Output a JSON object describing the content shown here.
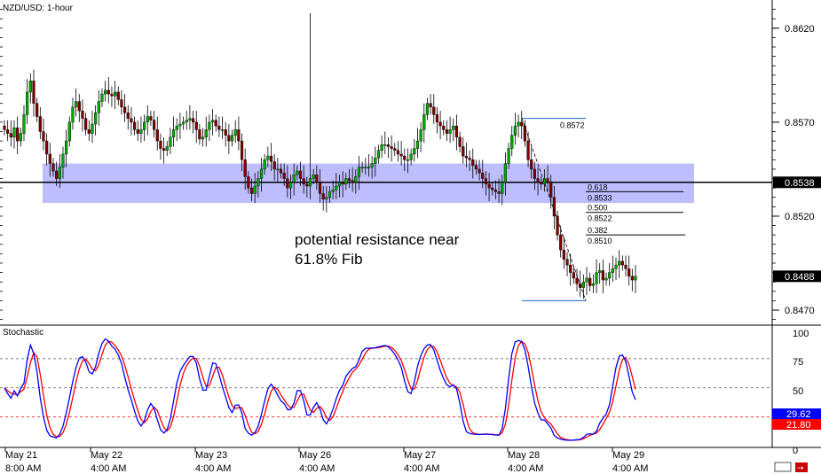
{
  "chart_data": {
    "type": "candlestick",
    "title": "NZD/USD: 1-hour",
    "price_axis": {
      "min": 0.8462,
      "max": 0.8635,
      "tick_labels": [
        "0.8620",
        "0.8570",
        "0.8520",
        "0.8470"
      ],
      "tick_values": [
        0.862,
        0.857,
        0.852,
        0.847
      ]
    },
    "time_axis": {
      "labels": [
        {
          "date": "May 21",
          "time": "8:00 AM"
        },
        {
          "date": "May 22",
          "time": "4:00 AM"
        },
        {
          "date": "May 23",
          "time": "4:00 AM"
        },
        {
          "date": "May 26",
          "time": "4:00 AM"
        },
        {
          "date": "May 27",
          "time": "4:00 AM"
        },
        {
          "date": "May 28",
          "time": "4:00 AM"
        },
        {
          "date": "May 29",
          "time": "4:00 AM"
        }
      ]
    },
    "current_price": {
      "label": "0.8488",
      "value": 0.8488
    },
    "horizontal_line": {
      "label": "0.8538",
      "value": 0.8538
    },
    "resistance_zone": {
      "low": 0.8527,
      "high": 0.8548
    },
    "fibonacci": {
      "high": {
        "label": "0.8572",
        "value": 0.8572
      },
      "low": {
        "value": 0.8475
      },
      "levels": [
        {
          "ratio": "0.618",
          "price": "0.8533",
          "value": 0.8533
        },
        {
          "ratio": "0.500",
          "price": "0.8522",
          "value": 0.8522
        },
        {
          "ratio": "0.382",
          "price": "0.8510",
          "value": 0.851
        }
      ]
    },
    "annotation": [
      "potential resistance near",
      "61.8% Fib"
    ],
    "candles_close": [
      0.8566,
      0.8564,
      0.8562,
      0.8567,
      0.856,
      0.8564,
      0.8574,
      0.8586,
      0.8592,
      0.858,
      0.8573,
      0.8565,
      0.856,
      0.8553,
      0.8548,
      0.8544,
      0.854,
      0.8546,
      0.8553,
      0.856,
      0.857,
      0.8578,
      0.8581,
      0.8576,
      0.8572,
      0.8566,
      0.8564,
      0.8569,
      0.8575,
      0.8581,
      0.8585,
      0.8587,
      0.8585,
      0.8584,
      0.8586,
      0.8582,
      0.8578,
      0.8575,
      0.8572,
      0.857,
      0.8566,
      0.8564,
      0.8566,
      0.857,
      0.8573,
      0.8571,
      0.8566,
      0.856,
      0.8556,
      0.8555,
      0.8557,
      0.8562,
      0.8566,
      0.8568,
      0.8569,
      0.857,
      0.8571,
      0.8572,
      0.857,
      0.8566,
      0.8561,
      0.8562,
      0.8566,
      0.857,
      0.8571,
      0.8568,
      0.8566,
      0.8566,
      0.8563,
      0.856,
      0.8563,
      0.8566,
      0.856,
      0.855,
      0.8541,
      0.8535,
      0.8532,
      0.8536,
      0.854,
      0.8545,
      0.855,
      0.8552,
      0.8549,
      0.8545,
      0.8545,
      0.8543,
      0.854,
      0.8535,
      0.8538,
      0.8542,
      0.8544,
      0.854,
      0.8537,
      0.8536,
      0.854,
      0.8542,
      0.8538,
      0.8532,
      0.8529,
      0.853,
      0.8533,
      0.8534,
      0.8536,
      0.8538,
      0.8537,
      0.854,
      0.8539,
      0.8538,
      0.8541,
      0.8546,
      0.8546,
      0.8546,
      0.8546,
      0.8548,
      0.8551,
      0.8555,
      0.8558,
      0.8558,
      0.8557,
      0.8556,
      0.8555,
      0.8553,
      0.8552,
      0.855,
      0.855,
      0.8553,
      0.8556,
      0.856,
      0.8566,
      0.8574,
      0.858,
      0.8578,
      0.8574,
      0.857,
      0.8568,
      0.8566,
      0.8564,
      0.8566,
      0.8568,
      0.8562,
      0.8557,
      0.8552,
      0.8551,
      0.855,
      0.8547,
      0.8545,
      0.8543,
      0.854,
      0.8537,
      0.8535,
      0.8534,
      0.8533,
      0.8532,
      0.8538,
      0.8548,
      0.8556,
      0.8563,
      0.8568,
      0.857,
      0.8568,
      0.856,
      0.855,
      0.8545,
      0.854,
      0.8538,
      0.8537,
      0.854,
      0.8538,
      0.853,
      0.852,
      0.851,
      0.8502,
      0.8497,
      0.8494,
      0.849,
      0.8487,
      0.8484,
      0.8482,
      0.8485,
      0.8487,
      0.8483,
      0.8484,
      0.849,
      0.8491,
      0.8486,
      0.8487,
      0.849,
      0.8492,
      0.8494,
      0.8496,
      0.8494,
      0.8492,
      0.8488,
      0.8486,
      0.8488
    ]
  },
  "stochastic": {
    "title": "Stochastic",
    "axis_labels": [
      "100",
      "75",
      "50",
      "0"
    ],
    "levels": [
      75,
      50,
      25
    ],
    "k_label": "29.62",
    "d_label": "21.80",
    "k_color": "#0000ff",
    "d_color": "#ff0000"
  },
  "colors": {
    "bull": "#00aa00",
    "bear": "#800000",
    "zone": "#9999ff",
    "fib": "#1e62c8",
    "current_tag_bg": "#000000",
    "current_tag_fg": "#ffffff"
  }
}
